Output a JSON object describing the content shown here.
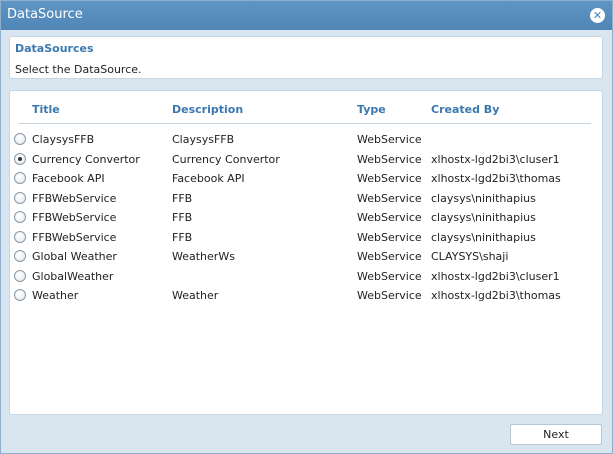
{
  "window": {
    "title": "DataSource"
  },
  "header_panel": {
    "heading": "DataSources",
    "instruction": "Select the DataSource."
  },
  "table": {
    "columns": [
      "Title",
      "Description",
      "Type",
      "Created By"
    ],
    "rows": [
      {
        "title": "ClaysysFFB",
        "description": "ClaysysFFB",
        "type": "WebService",
        "created_by": "",
        "selected": false
      },
      {
        "title": "Currency Convertor",
        "description": "Currency Convertor",
        "type": "WebService",
        "created_by": "xlhostx-lgd2bi3\\cluser1",
        "selected": true
      },
      {
        "title": "Facebook API",
        "description": "Facebook API",
        "type": "WebService",
        "created_by": "xlhostx-lgd2bi3\\thomas",
        "selected": false
      },
      {
        "title": "FFBWebService",
        "description": "FFB",
        "type": "WebService",
        "created_by": "claysys\\ninithapius",
        "selected": false
      },
      {
        "title": "FFBWebService",
        "description": "FFB",
        "type": "WebService",
        "created_by": "claysys\\ninithapius",
        "selected": false
      },
      {
        "title": "FFBWebService",
        "description": "FFB",
        "type": "WebService",
        "created_by": "claysys\\ninithapius",
        "selected": false
      },
      {
        "title": "Global Weather",
        "description": "WeatherWs",
        "type": "WebService",
        "created_by": "CLAYSYS\\shaji",
        "selected": false
      },
      {
        "title": "GlobalWeather",
        "description": "",
        "type": "WebService",
        "created_by": "xlhostx-lgd2bi3\\cluser1",
        "selected": false
      },
      {
        "title": "Weather",
        "description": "Weather",
        "type": "WebService",
        "created_by": "xlhostx-lgd2bi3\\thomas",
        "selected": false
      }
    ]
  },
  "footer": {
    "next_label": "Next"
  },
  "icons": {
    "close": "close-icon"
  },
  "colors": {
    "titlebar": "#4f86b6",
    "heading": "#3a78b0",
    "background": "#d9e6f0"
  }
}
